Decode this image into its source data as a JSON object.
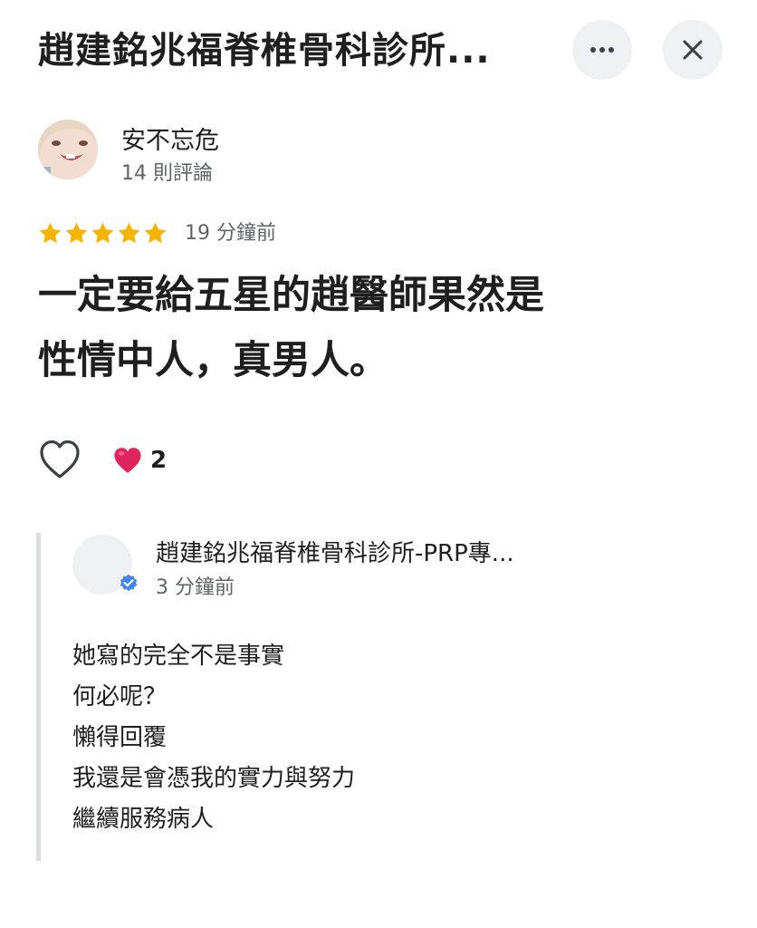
{
  "header": {
    "title": "趙建銘兆福脊椎骨科診所...",
    "more_icon": "more-horizontal-icon",
    "close_icon": "close-icon"
  },
  "review": {
    "author": "安不忘危",
    "author_meta": "14 則評論",
    "rating": 5,
    "rating_max": 5,
    "time": "19 分鐘前",
    "text": "一定要給五星的趙醫師果然是\n性情中人，真男人。",
    "reaction_count": "2",
    "star_color": "#F4B400"
  },
  "owner_reply": {
    "name": "趙建銘兆福脊椎骨科診所-PRP專...",
    "time": "3 分鐘前",
    "lines": [
      "她寫的完全不是事實",
      "何必呢？",
      "懶得回覆",
      "我還是會憑我的實力與努力",
      "繼續服務病人"
    ],
    "verified_color": "#4285F4"
  }
}
